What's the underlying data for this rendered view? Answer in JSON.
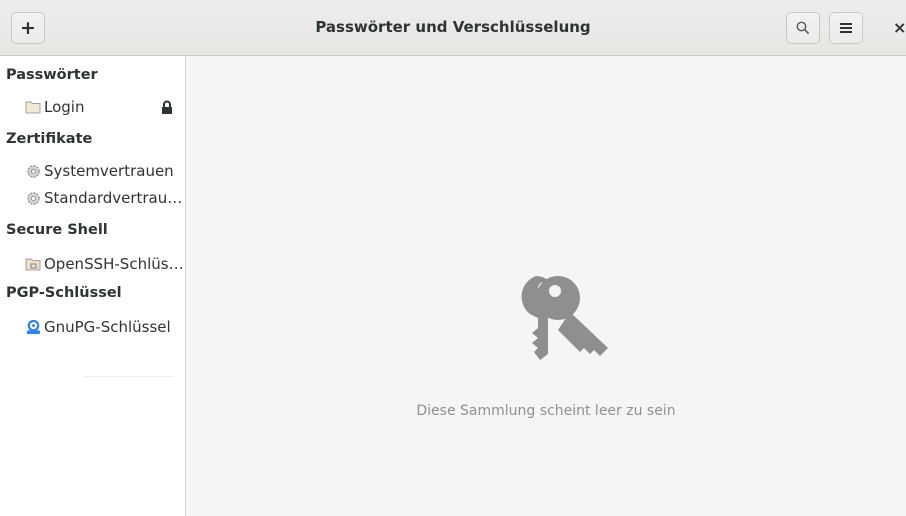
{
  "window": {
    "title": "Passwörter und Verschlüsselung",
    "add_label": "+",
    "close_label": "×"
  },
  "icons": {
    "add": "plus-icon",
    "search": "search-icon",
    "menu": "hamburger-menu-icon",
    "close": "close-icon",
    "folder": "folder-icon",
    "lock": "lock-icon",
    "gear": "gear-icon",
    "key": "key-icon",
    "empty": "keys-icon"
  },
  "sidebar": {
    "sections": [
      {
        "label": "Passwörter",
        "items": [
          {
            "label": "Login",
            "locked": true
          }
        ]
      },
      {
        "label": "Zertifikate",
        "items": [
          {
            "label": "Systemvertrauen"
          },
          {
            "label": "Standardvertrau…"
          }
        ]
      },
      {
        "label": "Secure Shell",
        "items": [
          {
            "label": "OpenSSH-Schlüs…"
          }
        ]
      },
      {
        "label": "PGP-Schlüssel",
        "items": [
          {
            "label": "GnuPG-Schlüssel"
          }
        ]
      }
    ]
  },
  "main": {
    "empty_message": "Diese Sammlung scheint leer zu sein"
  },
  "colors": {
    "headerbar": "#e8e6e3",
    "sidebar_bg": "#ffffff",
    "content_bg": "#f6f5f4",
    "empty_icon": "#8f8f8f",
    "gnupg_accent": "#3584e4"
  }
}
